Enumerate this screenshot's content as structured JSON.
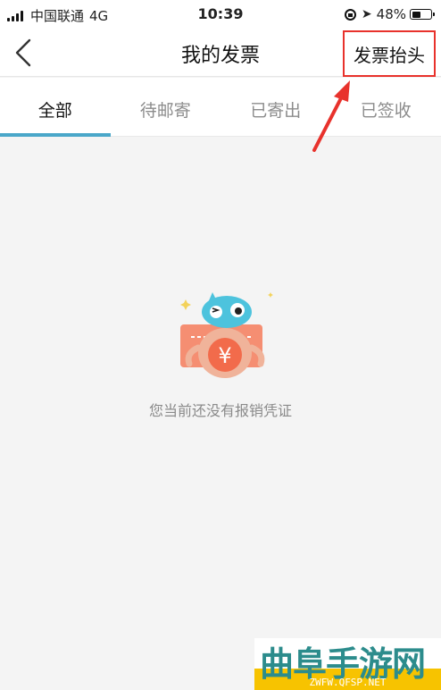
{
  "status_bar": {
    "carrier": "中国联通",
    "network": "4G",
    "time": "10:39",
    "battery_percent": "48%",
    "battery_level": 0.48
  },
  "nav": {
    "title": "我的发票",
    "header_button": "发票抬头"
  },
  "tabs": [
    {
      "label": "全部",
      "active": true
    },
    {
      "label": "待邮寄",
      "active": false
    },
    {
      "label": "已寄出",
      "active": false
    },
    {
      "label": "已签收",
      "active": false
    }
  ],
  "empty_state": {
    "icon": "mascot-receipt-icon",
    "message": "您当前还没有报销凭证"
  },
  "watermark": {
    "title": "曲阜手游网",
    "url": "ZWFW.QFSP.NET"
  },
  "colors": {
    "accent": "#4aa7c9",
    "highlight": "#e8322c",
    "background": "#f4f4f4"
  }
}
